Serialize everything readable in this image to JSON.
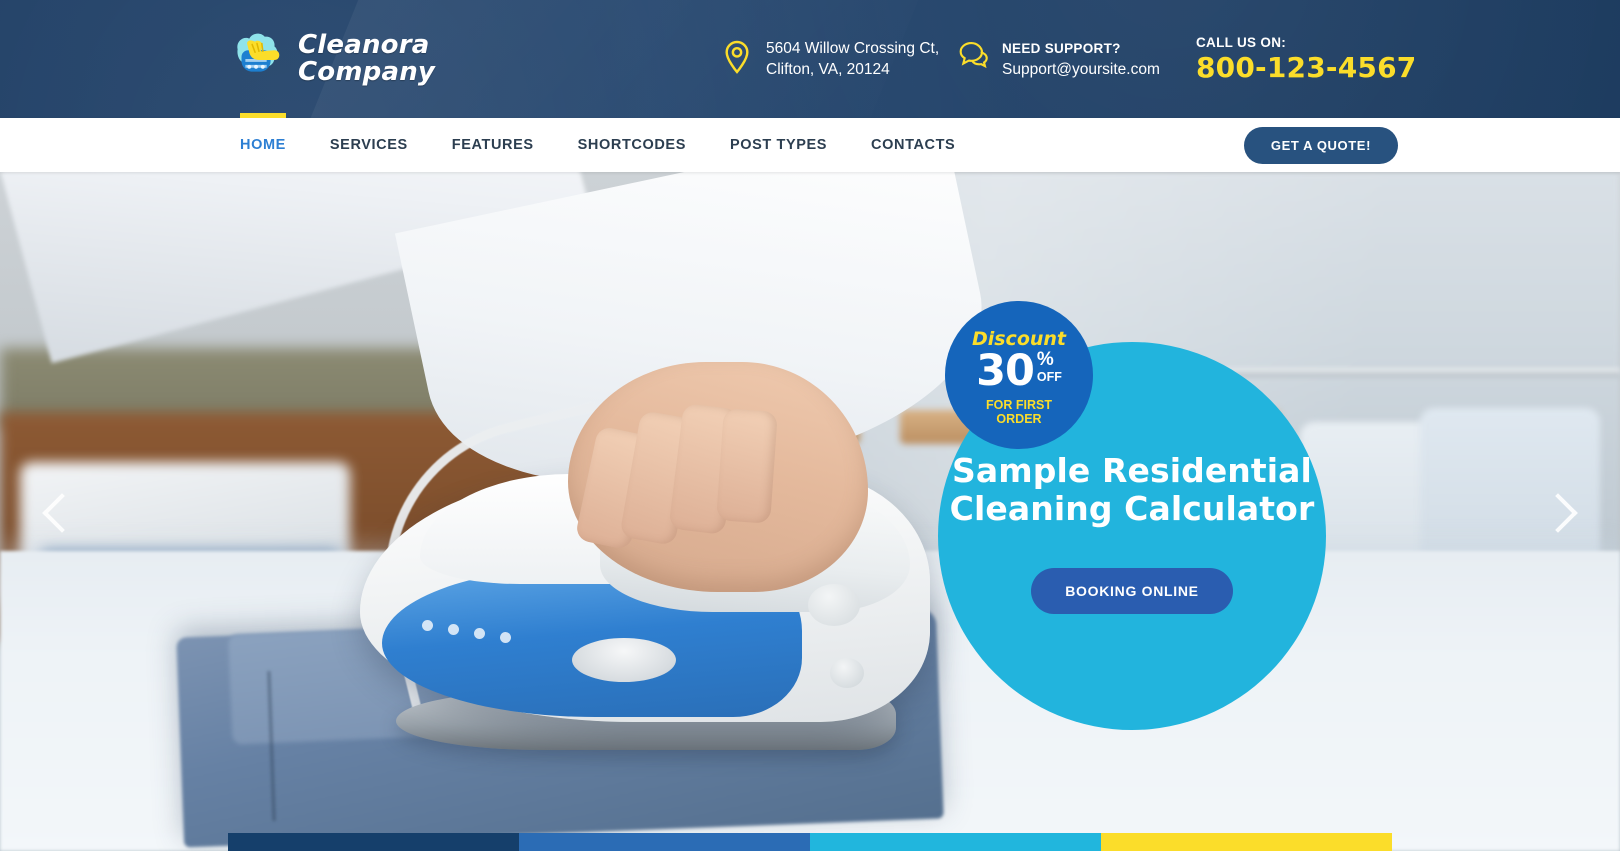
{
  "brand": {
    "logo_line1": "Cleanora",
    "logo_line2": "Company",
    "logo_icon": "washing-hand-logo-icon"
  },
  "colors": {
    "header_bg": "#1c3c63",
    "accent_yellow": "#fbdd2a",
    "nav_active": "#2d7fd3",
    "quote_button": "#28527f",
    "circle_cyan": "#22b4dd",
    "badge_blue": "#1565bb",
    "booking_button": "#2a5db0",
    "bar_1": "#153f6b",
    "bar_2": "#2b6cb5",
    "bar_3": "#21b6dd",
    "bar_4": "#fbdd2a"
  },
  "topbar": {
    "address": {
      "icon": "map-pin-icon",
      "line1": "5604 Willow Crossing Ct,",
      "line2": "Clifton, VA, 20124"
    },
    "support": {
      "icon": "chat-bubbles-icon",
      "label": "NEED SUPPORT?",
      "email": "Support@yoursite.com"
    },
    "call": {
      "label": "CALL US ON:",
      "number": "800-123-4567"
    }
  },
  "nav": {
    "items": [
      {
        "label": "HOME",
        "active": true
      },
      {
        "label": "SERVICES",
        "active": false
      },
      {
        "label": "FEATURES",
        "active": false
      },
      {
        "label": "SHORTCODES",
        "active": false
      },
      {
        "label": "POST TYPES",
        "active": false
      },
      {
        "label": "CONTACTS",
        "active": false
      }
    ],
    "quote_button": "GET A QUOTE!"
  },
  "hero": {
    "prev_arrow_icon": "chevron-left-icon",
    "next_arrow_icon": "chevron-right-icon",
    "badge": {
      "discount_word": "Discount",
      "number": "30",
      "percent": "%",
      "off": "OFF",
      "for_first_order": "FOR FIRST\nORDER"
    },
    "slide": {
      "title": "Sample Residential\nCleaning Calculator",
      "button": "BOOKING ONLINE"
    }
  },
  "colorbars": [
    {
      "name": "bar-dark-blue",
      "color": "#153f6b"
    },
    {
      "name": "bar-blue",
      "color": "#2b6cb5"
    },
    {
      "name": "bar-cyan",
      "color": "#21b6dd"
    },
    {
      "name": "bar-yellow",
      "color": "#fbdd2a"
    }
  ]
}
